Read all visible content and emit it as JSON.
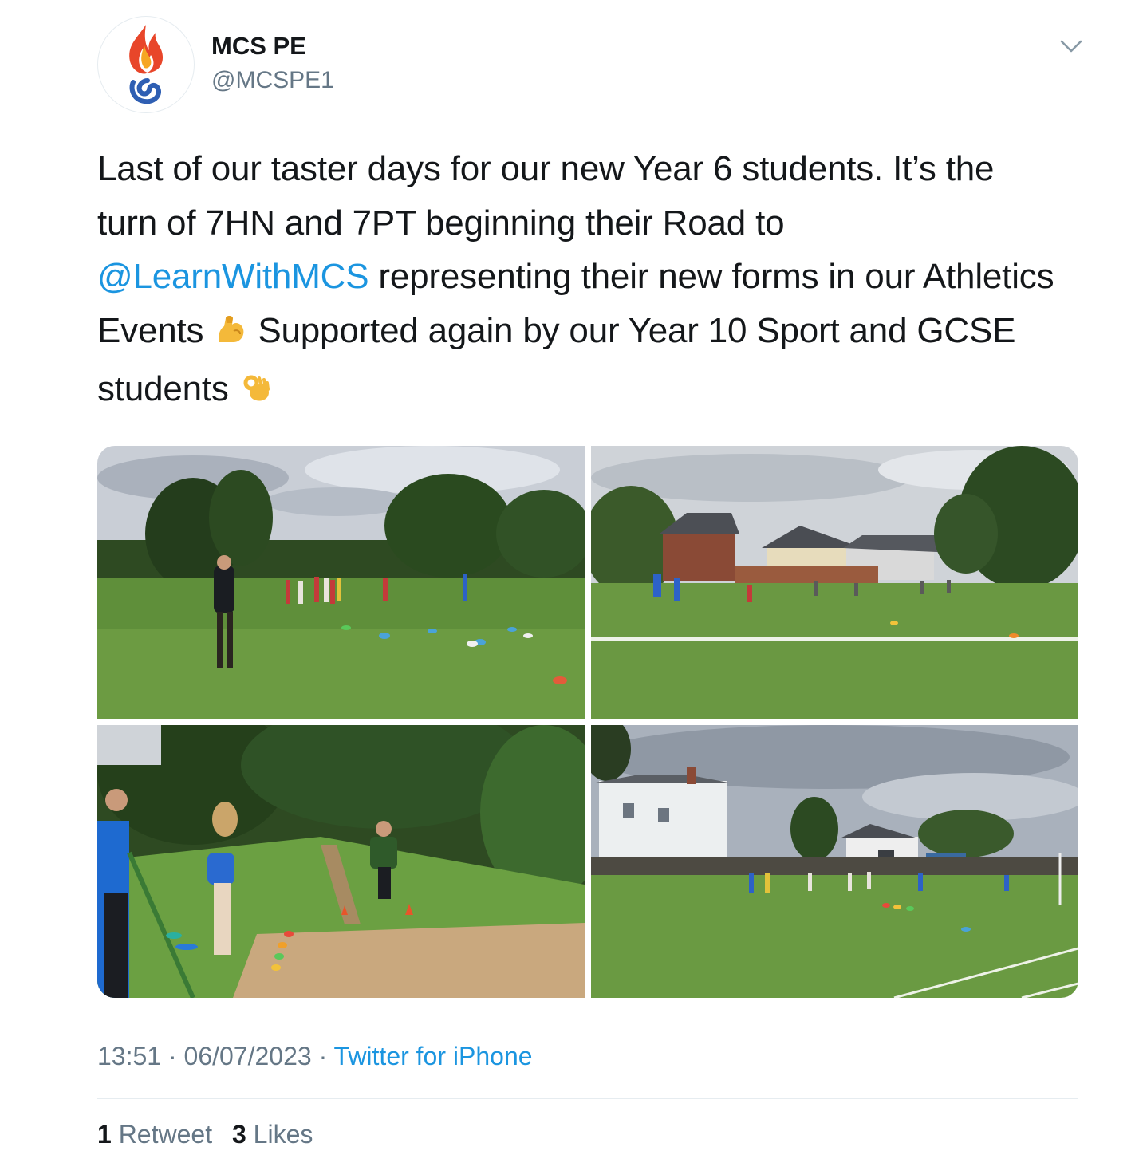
{
  "author": {
    "display_name": "MCS PE",
    "handle": "@MCSPE1",
    "avatar_icon": "flame-logo-icon"
  },
  "menu": {
    "icon": "chevron-down-icon"
  },
  "tweet": {
    "text_part1": "Last of our taster days for our new Year 6 students. It’s the turn of 7HN and 7PT beginning their Road to ",
    "mention": "@LearnWithMCS",
    "text_part2": " representing their new forms in our Athletics Events ",
    "emoji1": "flexed-biceps-emoji",
    "text_part3": " Supported again by our Year 10 Sport and GCSE students ",
    "emoji2": "ok-hand-emoji"
  },
  "media": {
    "photos": [
      "photo-athletics-field-group",
      "photo-field-with-houses",
      "photo-long-jump-sandpit",
      "photo-field-with-white-house"
    ]
  },
  "meta": {
    "time": "13:51",
    "separator": " · ",
    "date": "06/07/2023",
    "source": "Twitter for iPhone"
  },
  "stats": {
    "retweets_count": "1",
    "retweets_label": "Retweet",
    "likes_count": "3",
    "likes_label": "Likes"
  },
  "colors": {
    "link": "#1b95e0",
    "secondary_text": "#657786",
    "primary_text": "#14171a"
  }
}
